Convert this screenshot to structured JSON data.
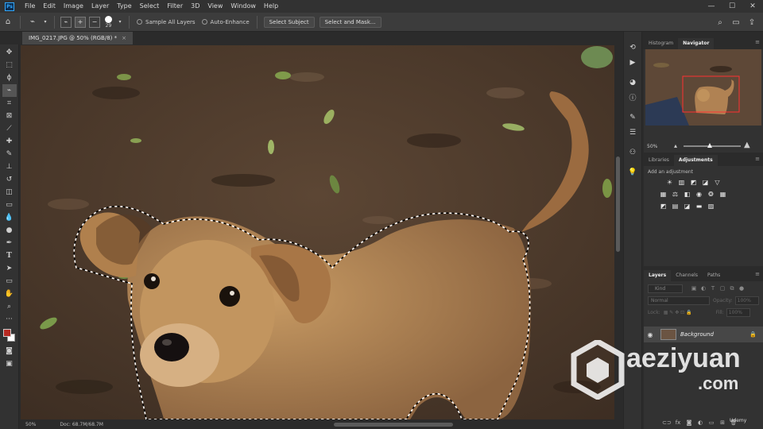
{
  "app": {
    "logo": "Ps"
  },
  "menu": [
    "File",
    "Edit",
    "Image",
    "Layer",
    "Type",
    "Select",
    "Filter",
    "3D",
    "View",
    "Window",
    "Help"
  ],
  "window_controls": {
    "minimize": "—",
    "maximize": "☐",
    "close": "✕"
  },
  "options": {
    "brush_size": "29",
    "sample_all_layers": "Sample All Layers",
    "auto_enhance": "Auto-Enhance",
    "select_subject": "Select Subject",
    "select_and_mask": "Select and Mask..."
  },
  "document": {
    "tab_title": "IMG_0217.JPG @ 50% (RGB/8) *",
    "close": "×"
  },
  "status": {
    "zoom": "50%",
    "doc_info": "Doc: 68.7M/68.7M"
  },
  "navigator": {
    "tabs": [
      "Histogram",
      "Navigator"
    ],
    "zoom": "50%"
  },
  "adjustments": {
    "tabs": [
      "Libraries",
      "Adjustments"
    ],
    "title": "Add an adjustment"
  },
  "layers": {
    "tabs": [
      "Layers",
      "Channels",
      "Paths"
    ],
    "filter_kind": "Kind",
    "blend_mode": "Normal",
    "opacity_label": "Opacity:",
    "opacity_value": "100%",
    "lock_label": "Lock:",
    "fill_label": "Fill:",
    "fill_value": "100%",
    "layer_name": "Background"
  },
  "watermark": {
    "brand": "aeziyuan",
    "domain": ".com",
    "udemy": "Udemy"
  }
}
